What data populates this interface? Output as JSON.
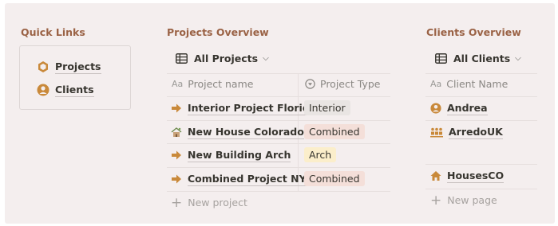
{
  "quick_links": {
    "title": "Quick Links",
    "items": [
      {
        "label": "Projects",
        "icon": "hexagon-icon"
      },
      {
        "label": "Clients",
        "icon": "person-circle-icon"
      }
    ]
  },
  "projects": {
    "title": "Projects Overview",
    "view_label": "All Projects",
    "columns": [
      {
        "label": "Project name",
        "icon": "text-aa-icon"
      },
      {
        "label": "Project Type",
        "icon": "select-circle-icon"
      }
    ],
    "rows": [
      {
        "name": "Interior Project Florida",
        "icon": "arrow-right-icon",
        "type": "Interior",
        "type_color": "#e9e5e3"
      },
      {
        "name": "New House Colorado",
        "icon": "house-image-icon",
        "type": "Combined",
        "type_color": "#f4dfd9"
      },
      {
        "name": "New Building Arch",
        "icon": "arrow-right-icon",
        "type": "Arch",
        "type_color": "#fbeecb"
      },
      {
        "name": "Combined Project NY",
        "icon": "arrow-right-icon",
        "type": "Combined",
        "type_color": "#f4dfd9"
      }
    ],
    "new_label": "New project"
  },
  "clients": {
    "title": "Clients Overview",
    "view_label": "All Clients",
    "column": {
      "label": "Client Name",
      "icon": "text-aa-icon"
    },
    "rows": [
      {
        "name": "Andrea",
        "icon": "person-circle-icon"
      },
      {
        "name": "ArredoUK",
        "icon": "people-group-icon"
      },
      {
        "name": "HousesCO",
        "icon": "house-icon"
      }
    ],
    "new_label": "New page"
  },
  "colors": {
    "accent": "#c9893a",
    "title": "#9a6245",
    "background": "#f4eeee"
  }
}
